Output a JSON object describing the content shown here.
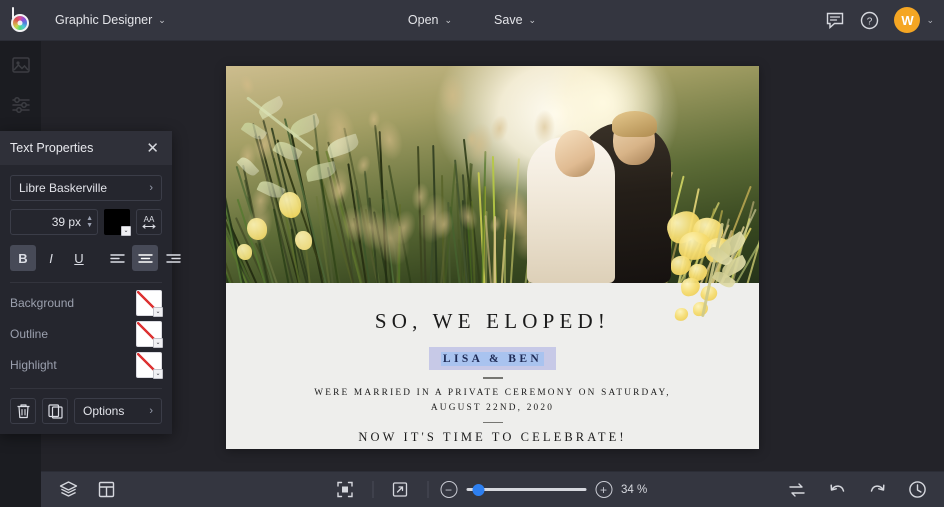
{
  "app": {
    "logo_icon": "color-wheel-b-logo",
    "document_title": "Graphic Designer"
  },
  "topbar": {
    "open_label": "Open",
    "save_label": "Save",
    "comments_icon": "comment-icon",
    "help_icon": "help-icon",
    "avatar_initial": "W",
    "avatar_color": "#f5a623",
    "caret": "⌄"
  },
  "left_rail": {
    "items": [
      {
        "icon": "image-icon"
      },
      {
        "icon": "adjustments-sliders-icon"
      },
      {
        "icon": "text-icon"
      }
    ]
  },
  "panel": {
    "title": "Text Properties",
    "close_icon": "close-icon",
    "font_family": "Libre Baskerville",
    "font_size": "39 px",
    "text_color": "#000000",
    "spacing_icon": "letter-spacing-icon",
    "chevron": "›",
    "format": {
      "bold_label": "B",
      "italic_label": "I",
      "underline_label": "U",
      "bold_active": true,
      "align_left_icon": "align-left-icon",
      "align_center_icon": "align-center-icon",
      "align_right_icon": "align-right-icon",
      "align_active": "center"
    },
    "properties": [
      {
        "label": "Background",
        "value": "none"
      },
      {
        "label": "Outline",
        "value": "none"
      },
      {
        "label": "Highlight",
        "value": "none"
      }
    ],
    "delete_icon": "trash-icon",
    "duplicate_icon": "duplicate-icon",
    "options_label": "Options"
  },
  "canvas": {
    "card": {
      "headline": "SO, WE ELOPED!",
      "names": "LISA & BEN",
      "body_line_1": "WERE MARRIED IN A PRIVATE CEREMONY ON SATURDAY,",
      "body_line_2": "AUGUST 22ND, 2020",
      "closing": "NOW IT'S TIME TO CELEBRATE!",
      "selection_color": "#c7c9e7",
      "text_highlight_color": "#a9c3ef"
    }
  },
  "bottombar": {
    "layers_icon": "layers-icon",
    "pages_icon": "pages-layout-icon",
    "fit_icon": "fit-to-screen-icon",
    "expand_icon": "expand-icon",
    "zoom_out_label": "−",
    "zoom_in_label": "+",
    "zoom_level": "34 %",
    "swap_icon": "swap-icon",
    "undo_icon": "undo-icon",
    "redo_icon": "redo-icon",
    "history_icon": "history-clock-icon"
  }
}
